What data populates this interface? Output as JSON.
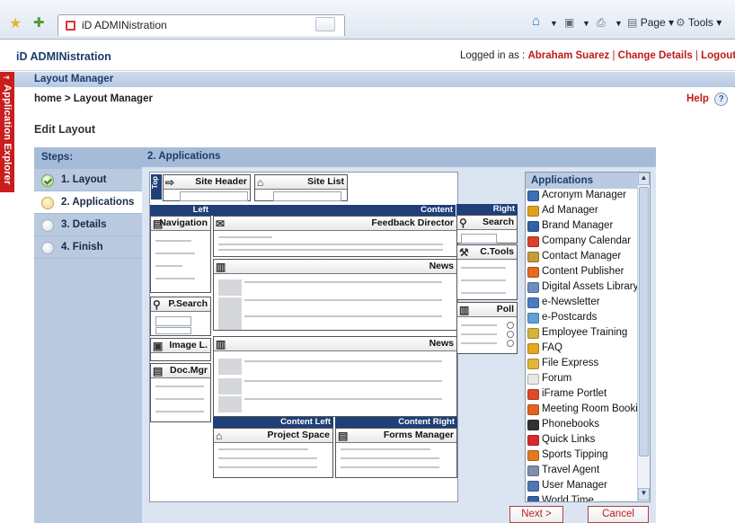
{
  "browser": {
    "tab_title": "iD ADMINistration",
    "menu_page": "Page",
    "menu_tools": "Tools"
  },
  "header": {
    "app_title": "iD ADMINistration",
    "logged_in_label": "Logged in as :",
    "user_name": "Abraham Suarez",
    "sep1": "|",
    "change_details": "Change Details",
    "sep2": "|",
    "logout": "Logout"
  },
  "side_tab": "Application Explorer",
  "page_title": "Layout Manager",
  "breadcrumb": "home > Layout Manager",
  "help": "Help",
  "section_title": "Edit Layout",
  "steps": {
    "header": "Steps:",
    "items": [
      {
        "label": "1. Layout",
        "state": "done"
      },
      {
        "label": "2. Applications",
        "state": "current"
      },
      {
        "label": "3. Details",
        "state": "todo"
      },
      {
        "label": "4. Finish",
        "state": "todo"
      }
    ]
  },
  "main_header": "2. Applications",
  "layout": {
    "top_label": "Top",
    "site_header": "Site Header",
    "site_list": "Site List",
    "col_left": "Left",
    "col_content": "Content",
    "col_right": "Right",
    "col_content_left": "Content Left",
    "col_content_right": "Content Right",
    "navigation": "Navigation",
    "feedback_director": "Feedback Director",
    "search": "Search",
    "news1": "News",
    "news2": "News",
    "ctools": "C.Tools",
    "psearch": "P.Search",
    "poll": "Poll",
    "imagel": "Image L.",
    "docmgr": "Doc.Mgr",
    "project_space": "Project Space",
    "forms_manager": "Forms Manager"
  },
  "applications": {
    "header": "Applications",
    "items": [
      {
        "label": "Acronym Manager",
        "icon": "abc-icon",
        "color": "#3b6fb6"
      },
      {
        "label": "Ad Manager",
        "icon": "ad-icon",
        "color": "#e0a21c"
      },
      {
        "label": "Brand Manager",
        "icon": "brand-icon",
        "color": "#2f62a8"
      },
      {
        "label": "Company Calendar",
        "icon": "calendar-icon",
        "color": "#d9412b"
      },
      {
        "label": "Contact Manager",
        "icon": "contact-icon",
        "color": "#c79a3a"
      },
      {
        "label": "Content Publisher",
        "icon": "publisher-icon",
        "color": "#e66a1f"
      },
      {
        "label": "Digital Assets Library",
        "icon": "assets-icon",
        "color": "#6a8fbf"
      },
      {
        "label": "e-Newsletter",
        "icon": "newsletter-icon",
        "color": "#4a7cc2"
      },
      {
        "label": "e-Postcards",
        "icon": "postcard-icon",
        "color": "#5fa0d8"
      },
      {
        "label": "Employee Training",
        "icon": "training-icon",
        "color": "#d9b23a"
      },
      {
        "label": "FAQ",
        "icon": "faq-icon",
        "color": "#e7a71e"
      },
      {
        "label": "File Express",
        "icon": "file-icon",
        "color": "#e4b53c"
      },
      {
        "label": "Forum",
        "icon": "forum-icon",
        "color": "#e8e8e8"
      },
      {
        "label": "iFrame Portlet",
        "icon": "iframe-icon",
        "color": "#e04a2a"
      },
      {
        "label": "Meeting Room Bookin",
        "icon": "meeting-icon",
        "color": "#e0641d"
      },
      {
        "label": "Phonebooks",
        "icon": "phonebook-icon",
        "color": "#333333"
      },
      {
        "label": "Quick Links",
        "icon": "link-icon",
        "color": "#d62b2b"
      },
      {
        "label": "Sports Tipping",
        "icon": "sports-icon",
        "color": "#e07b22"
      },
      {
        "label": "Travel Agent",
        "icon": "travel-icon",
        "color": "#7d8fab"
      },
      {
        "label": "User Manager",
        "icon": "user-icon",
        "color": "#4f77b3"
      },
      {
        "label": "World Time",
        "icon": "world-icon",
        "color": "#3561a8"
      }
    ]
  },
  "buttons": {
    "next": "Next >",
    "cancel": "Cancel"
  }
}
